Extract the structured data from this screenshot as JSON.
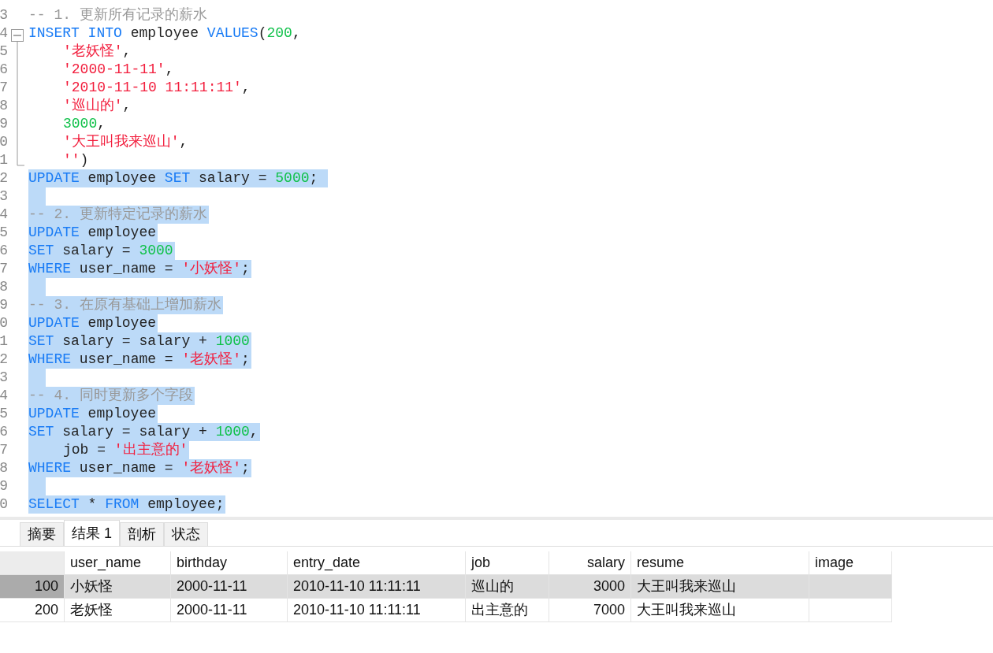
{
  "editor": {
    "lines": [
      {
        "number": "3",
        "selected": false,
        "kind": "plain",
        "tokens": [
          {
            "kind": "comment",
            "text": "-- 1. 更新所有记录的薪水"
          }
        ]
      },
      {
        "number": "4",
        "selected": false,
        "kind": "fold_start",
        "tokens": [
          {
            "kind": "keyword",
            "text": "INSERT INTO"
          },
          {
            "kind": "plain",
            "text": " employee "
          },
          {
            "kind": "keyword",
            "text": "VALUES"
          },
          {
            "kind": "plain",
            "text": "("
          },
          {
            "kind": "number",
            "text": "200"
          },
          {
            "kind": "plain",
            "text": ","
          }
        ]
      },
      {
        "number": "5",
        "selected": false,
        "kind": "fold_body",
        "indented": true,
        "tokens": [
          {
            "kind": "string",
            "text": "'老妖怪'"
          },
          {
            "kind": "plain",
            "text": ","
          }
        ]
      },
      {
        "number": "6",
        "selected": false,
        "kind": "fold_body",
        "indented": true,
        "tokens": [
          {
            "kind": "string",
            "text": "'2000-11-11'"
          },
          {
            "kind": "plain",
            "text": ","
          }
        ]
      },
      {
        "number": "7",
        "selected": false,
        "kind": "fold_body",
        "indented": true,
        "tokens": [
          {
            "kind": "string",
            "text": "'2010-11-10 11:11:11'"
          },
          {
            "kind": "plain",
            "text": ","
          }
        ]
      },
      {
        "number": "8",
        "selected": false,
        "kind": "fold_body",
        "indented": true,
        "tokens": [
          {
            "kind": "string",
            "text": "'巡山的'"
          },
          {
            "kind": "plain",
            "text": ","
          }
        ]
      },
      {
        "number": "9",
        "selected": false,
        "kind": "fold_body",
        "indented": true,
        "tokens": [
          {
            "kind": "number",
            "text": "3000"
          },
          {
            "kind": "plain",
            "text": ","
          }
        ]
      },
      {
        "number": "0",
        "selected": false,
        "kind": "fold_body",
        "indented": true,
        "tokens": [
          {
            "kind": "string",
            "text": "'大王叫我来巡山'"
          },
          {
            "kind": "plain",
            "text": ","
          }
        ]
      },
      {
        "number": "1",
        "selected": false,
        "kind": "fold_end",
        "indented": true,
        "tokens": [
          {
            "kind": "string",
            "text": "''"
          },
          {
            "kind": "plain",
            "text": ")"
          }
        ]
      },
      {
        "number": "2",
        "selected": true,
        "kind": "plain",
        "tokens": [
          {
            "kind": "keyword",
            "text": "UPDATE"
          },
          {
            "kind": "plain",
            "text": " employee "
          },
          {
            "kind": "keyword",
            "text": "SET"
          },
          {
            "kind": "plain",
            "text": " salary = "
          },
          {
            "kind": "number",
            "text": "5000"
          },
          {
            "kind": "plain",
            "text": "; "
          }
        ]
      },
      {
        "number": "3",
        "selected": true,
        "kind": "plain"
      },
      {
        "number": "4",
        "selected": true,
        "kind": "plain",
        "tokens": [
          {
            "kind": "comment",
            "text": "-- 2. 更新特定记录的薪水"
          }
        ]
      },
      {
        "number": "5",
        "selected": true,
        "kind": "plain",
        "tokens": [
          {
            "kind": "keyword",
            "text": "UPDATE"
          },
          {
            "kind": "plain",
            "text": " employee"
          }
        ]
      },
      {
        "number": "6",
        "selected": true,
        "kind": "plain",
        "tokens": [
          {
            "kind": "keyword",
            "text": "SET"
          },
          {
            "kind": "plain",
            "text": " salary = "
          },
          {
            "kind": "number",
            "text": "3000"
          }
        ]
      },
      {
        "number": "7",
        "selected": true,
        "kind": "plain",
        "tokens": [
          {
            "kind": "keyword",
            "text": "WHERE"
          },
          {
            "kind": "plain",
            "text": " user_name = "
          },
          {
            "kind": "string",
            "text": "'小妖怪'"
          },
          {
            "kind": "plain",
            "text": ";"
          }
        ]
      },
      {
        "number": "8",
        "selected": true,
        "kind": "plain"
      },
      {
        "number": "9",
        "selected": true,
        "kind": "plain",
        "tokens": [
          {
            "kind": "comment",
            "text": "-- 3. 在原有基础上增加薪水"
          }
        ]
      },
      {
        "number": "0",
        "selected": true,
        "kind": "plain",
        "tokens": [
          {
            "kind": "keyword",
            "text": "UPDATE"
          },
          {
            "kind": "plain",
            "text": " employee"
          }
        ]
      },
      {
        "number": "1",
        "selected": true,
        "kind": "plain",
        "tokens": [
          {
            "kind": "keyword",
            "text": "SET"
          },
          {
            "kind": "plain",
            "text": " salary = salary + "
          },
          {
            "kind": "number",
            "text": "1000"
          }
        ]
      },
      {
        "number": "2",
        "selected": true,
        "kind": "plain",
        "tokens": [
          {
            "kind": "keyword",
            "text": "WHERE"
          },
          {
            "kind": "plain",
            "text": " user_name = "
          },
          {
            "kind": "string",
            "text": "'老妖怪'"
          },
          {
            "kind": "plain",
            "text": ";"
          }
        ]
      },
      {
        "number": "3",
        "selected": true,
        "kind": "plain"
      },
      {
        "number": "4",
        "selected": true,
        "kind": "plain",
        "tokens": [
          {
            "kind": "comment",
            "text": "-- 4. 同时更新多个字段"
          }
        ]
      },
      {
        "number": "5",
        "selected": true,
        "kind": "plain",
        "tokens": [
          {
            "kind": "keyword",
            "text": "UPDATE"
          },
          {
            "kind": "plain",
            "text": " employee"
          }
        ]
      },
      {
        "number": "6",
        "selected": true,
        "kind": "plain",
        "tokens": [
          {
            "kind": "keyword",
            "text": "SET"
          },
          {
            "kind": "plain",
            "text": " salary = salary + "
          },
          {
            "kind": "number",
            "text": "1000"
          },
          {
            "kind": "plain",
            "text": ","
          }
        ]
      },
      {
        "number": "7",
        "selected": true,
        "kind": "plain",
        "indented": true,
        "tokens": [
          {
            "kind": "plain",
            "text": "job = "
          },
          {
            "kind": "string",
            "text": "'出主意的'"
          }
        ]
      },
      {
        "number": "8",
        "selected": true,
        "kind": "plain",
        "tokens": [
          {
            "kind": "keyword",
            "text": "WHERE"
          },
          {
            "kind": "plain",
            "text": " user_name = "
          },
          {
            "kind": "string",
            "text": "'老妖怪'"
          },
          {
            "kind": "plain",
            "text": ";"
          }
        ]
      },
      {
        "number": "9",
        "selected": true,
        "kind": "plain"
      },
      {
        "number": "0",
        "selected": true,
        "kind": "plain",
        "tokens": [
          {
            "kind": "keyword",
            "text": "SELECT"
          },
          {
            "kind": "plain",
            "text": " * "
          },
          {
            "kind": "keyword",
            "text": "FROM"
          },
          {
            "kind": "plain",
            "text": " employee;"
          }
        ]
      }
    ]
  },
  "tabs": [
    {
      "label": "摘要",
      "selected": false
    },
    {
      "label": "结果 1",
      "selected": true
    },
    {
      "label": "剖析",
      "selected": false
    },
    {
      "label": "状态",
      "selected": false
    }
  ],
  "table": {
    "columns": [
      "user_name",
      "birthday",
      "entry_date",
      "job",
      "salary",
      "resume",
      "image"
    ],
    "rows": [
      {
        "row_header": "100",
        "selected": true,
        "cells": [
          "小妖怪",
          "2000-11-11",
          "2010-11-10 11:11:11",
          "巡山的",
          "3000",
          "大王叫我来巡山",
          ""
        ]
      },
      {
        "row_header": "200",
        "selected": false,
        "cells": [
          "老妖怪",
          "2000-11-11",
          "2010-11-10 11:11:11",
          "出主意的",
          "7000",
          "大王叫我来巡山",
          ""
        ]
      }
    ]
  }
}
